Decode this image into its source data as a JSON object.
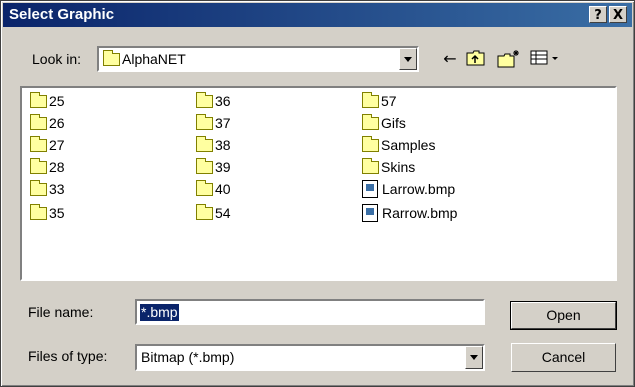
{
  "window": {
    "title": "Select Graphic",
    "help_label": "?",
    "close_label": "X"
  },
  "toolbar": {
    "look_in_label": "Look in:",
    "look_in_value": "AlphaNET",
    "back_icon": "back-arrow-icon",
    "up_icon": "up-one-level-icon",
    "new_folder_icon": "create-new-folder-icon",
    "view_menu_icon": "view-menu-icon"
  },
  "files": {
    "column1": [
      "25",
      "26",
      "27",
      "28",
      "33",
      "35"
    ],
    "column2": [
      "36",
      "37",
      "38",
      "39",
      "40",
      "54"
    ],
    "column3_folders": [
      "57",
      "Gifs",
      "Samples",
      "Skins"
    ],
    "column3_files": [
      "Larrow.bmp",
      "Rarrow.bmp"
    ]
  },
  "form": {
    "file_name_label": "File name:",
    "file_name_value": "*.bmp",
    "file_type_label": "Files of type:",
    "file_type_value": "Bitmap (*.bmp)",
    "open_label": "Open",
    "cancel_label": "Cancel"
  }
}
